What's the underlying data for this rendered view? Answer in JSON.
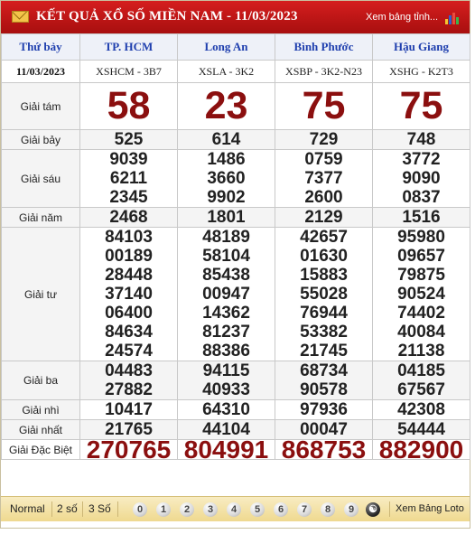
{
  "header": {
    "title": "KẾT QUẢ XỔ SỐ MIỀN NAM - 11/03/2023",
    "calendar_link": "Xem bảng tỉnh..."
  },
  "table": {
    "day": "Thứ bảy",
    "date": "11/03/2023",
    "provinces": [
      "TP. HCM",
      "Long An",
      "Bình Phước",
      "Hậu Giang"
    ],
    "codes": [
      "XSHCM - 3B7",
      "XSLA - 3K2",
      "XSBP - 3K2-N23",
      "XSHG - K2T3"
    ],
    "prizes": [
      {
        "label": "Giải tám",
        "values": [
          [
            "58"
          ],
          [
            "23"
          ],
          [
            "75"
          ],
          [
            "75"
          ]
        ]
      },
      {
        "label": "Giải bảy",
        "values": [
          [
            "525"
          ],
          [
            "614"
          ],
          [
            "729"
          ],
          [
            "748"
          ]
        ]
      },
      {
        "label": "Giải sáu",
        "values": [
          [
            "9039",
            "6211",
            "2345"
          ],
          [
            "1486",
            "3660",
            "9902"
          ],
          [
            "0759",
            "7377",
            "2600"
          ],
          [
            "3772",
            "9090",
            "0837"
          ]
        ]
      },
      {
        "label": "Giải năm",
        "values": [
          [
            "2468"
          ],
          [
            "1801"
          ],
          [
            "2129"
          ],
          [
            "1516"
          ]
        ]
      },
      {
        "label": "Giải tư",
        "values": [
          [
            "84103",
            "00189",
            "28448",
            "37140",
            "06400",
            "84634",
            "24574"
          ],
          [
            "48189",
            "58104",
            "85438",
            "00947",
            "14362",
            "81237",
            "88386"
          ],
          [
            "42657",
            "01630",
            "15883",
            "55028",
            "76944",
            "53382",
            "21745"
          ],
          [
            "95980",
            "09657",
            "79875",
            "90524",
            "74402",
            "40084",
            "21138"
          ]
        ]
      },
      {
        "label": "Giải ba",
        "values": [
          [
            "04483",
            "27882"
          ],
          [
            "94115",
            "40933"
          ],
          [
            "68734",
            "90578"
          ],
          [
            "04185",
            "67567"
          ]
        ]
      },
      {
        "label": "Giải nhì",
        "values": [
          [
            "10417"
          ],
          [
            "64310"
          ],
          [
            "97936"
          ],
          [
            "42308"
          ]
        ]
      },
      {
        "label": "Giải nhất",
        "values": [
          [
            "21765"
          ],
          [
            "44104"
          ],
          [
            "00047"
          ],
          [
            "54444"
          ]
        ]
      },
      {
        "label": "Giải Đặc Biệt",
        "values": [
          [
            "270765"
          ],
          [
            "804991"
          ],
          [
            "868753"
          ],
          [
            "882900"
          ]
        ]
      }
    ]
  },
  "footer": {
    "modes": [
      "Normal",
      "2 số",
      "3 Số"
    ],
    "digits": [
      "0",
      "1",
      "2",
      "3",
      "4",
      "5",
      "6",
      "7",
      "8",
      "9"
    ],
    "loto_link": "Xem Bảng Loto"
  },
  "colors": {
    "header_bg": "#c41717",
    "province_text": "#1f3fae",
    "big_number": "#8b0f0f",
    "footer_bg": "#f3e3a6"
  },
  "icons": [
    "mail-icon",
    "bar-chart-icon",
    "yin-yang-icon"
  ]
}
